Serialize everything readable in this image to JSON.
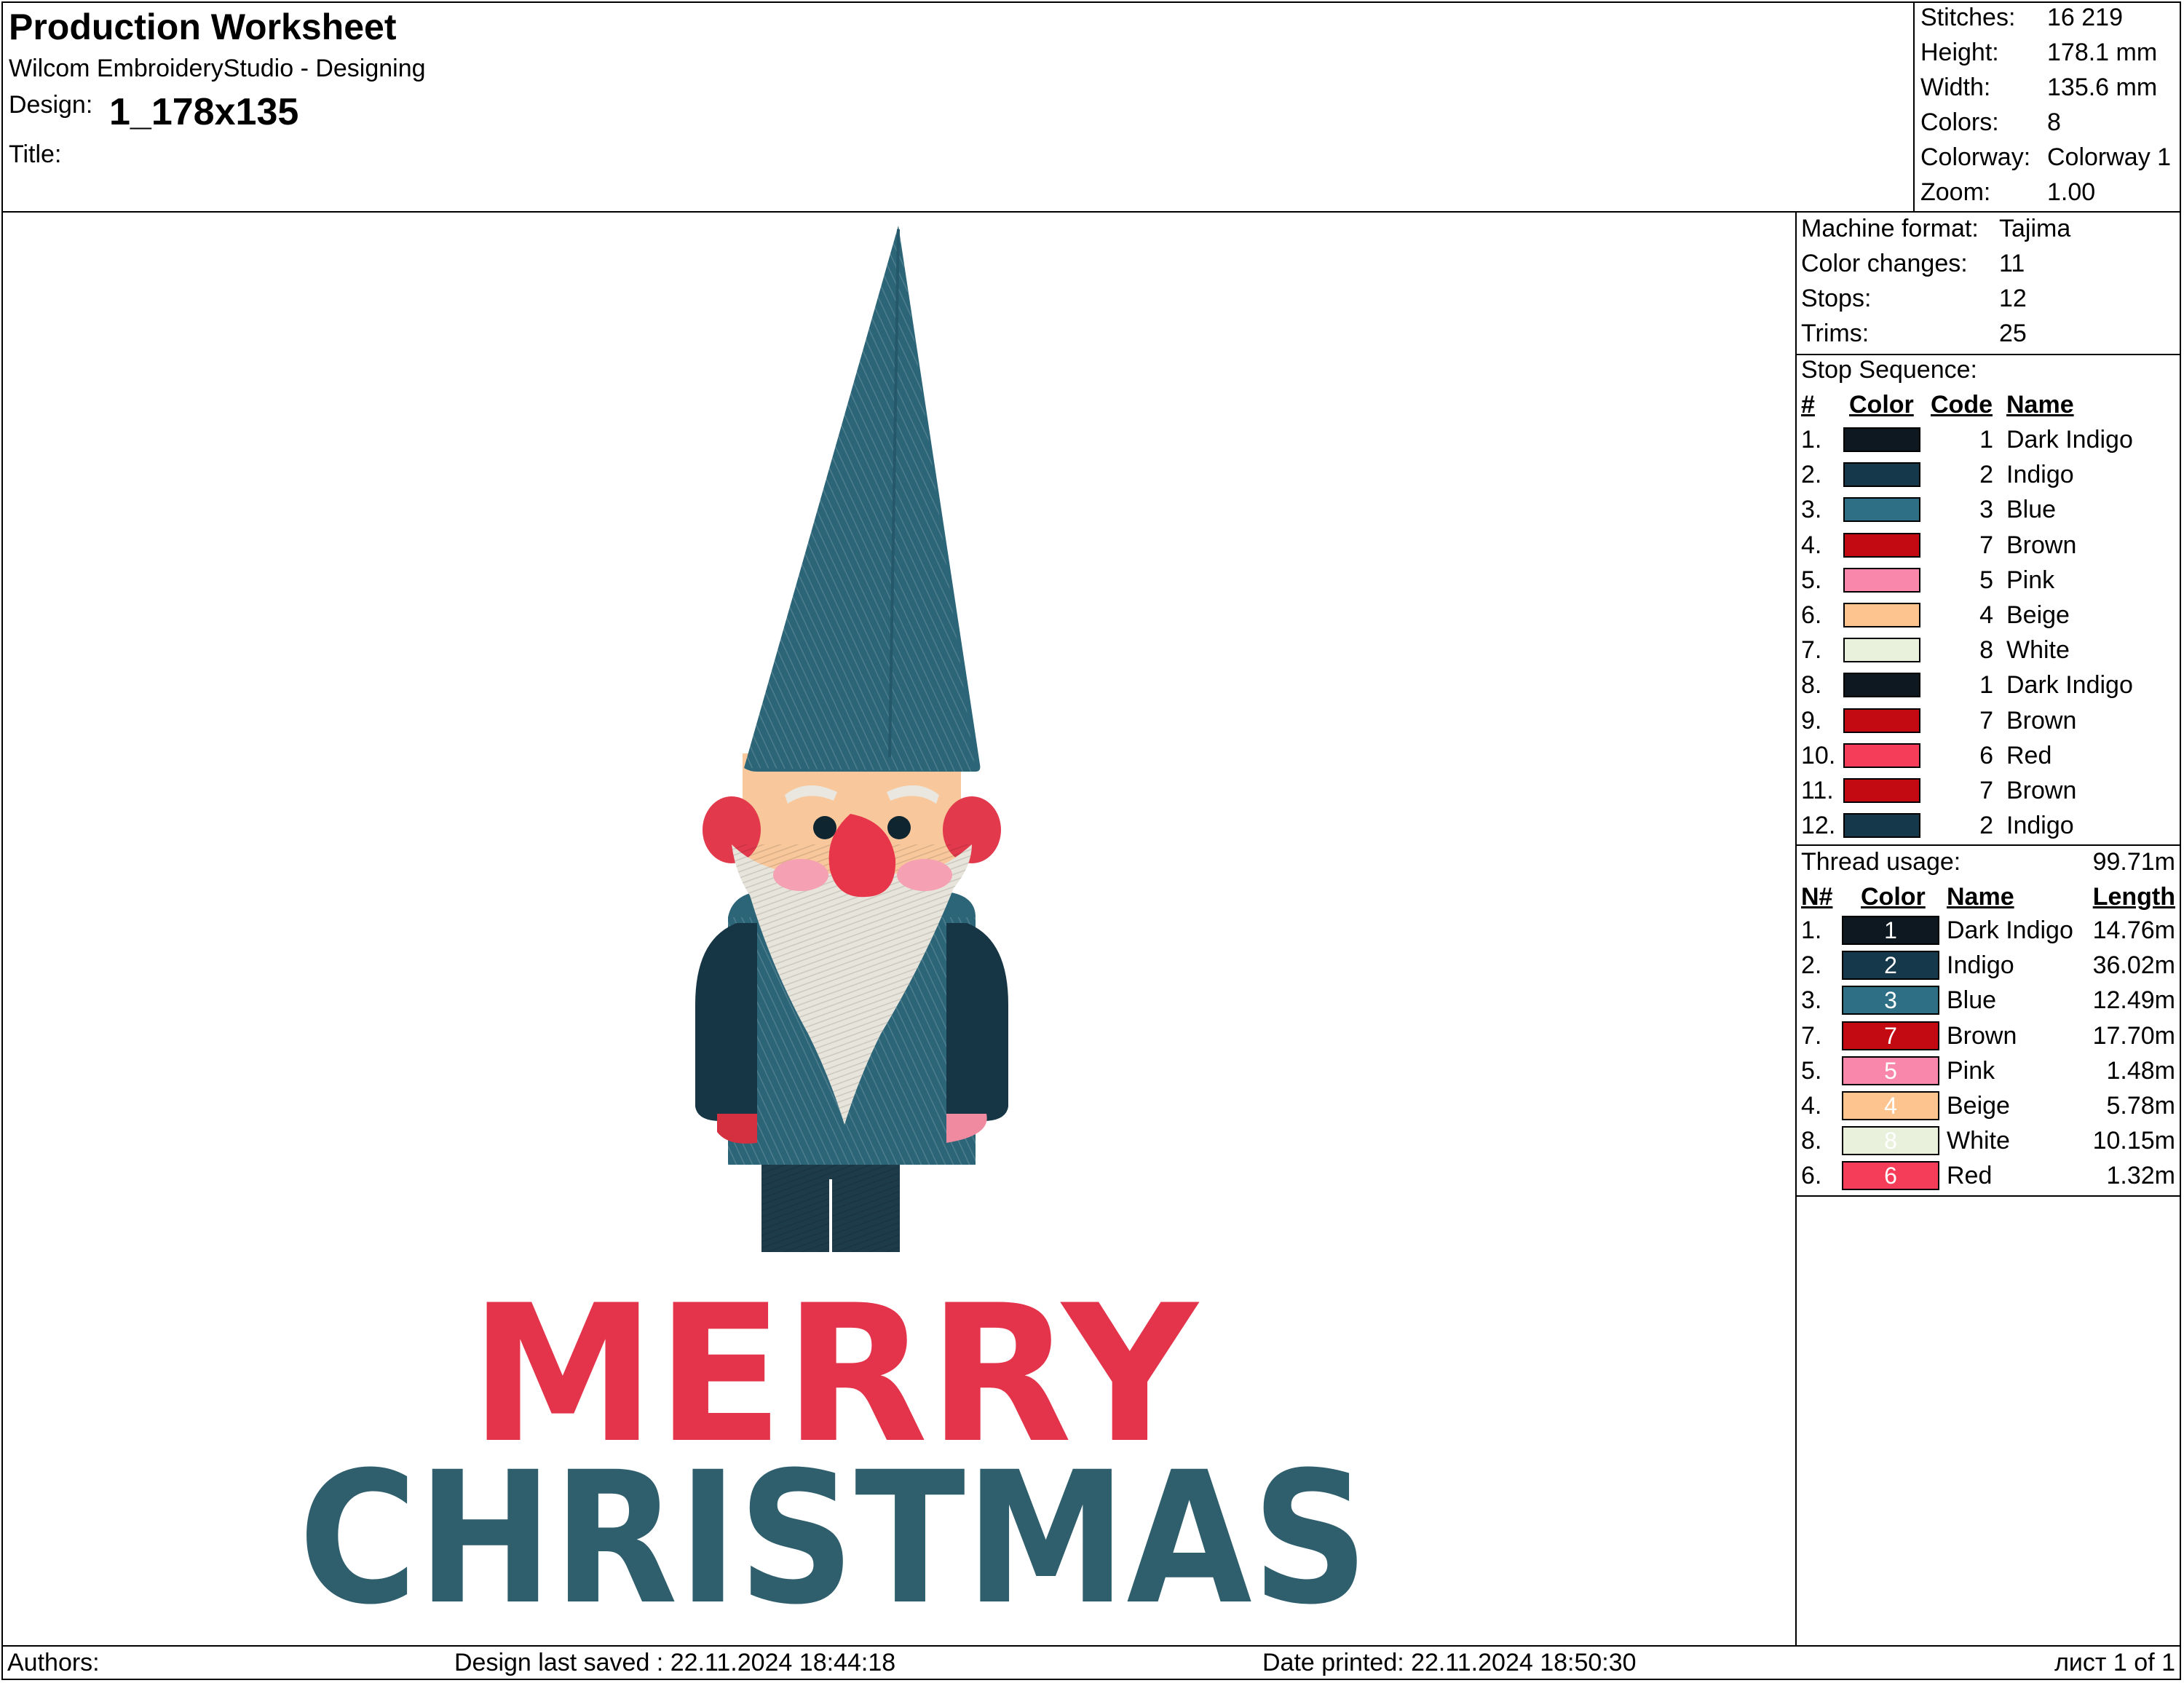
{
  "header": {
    "title": "Production Worksheet",
    "app": "Wilcom EmbroideryStudio - Designing",
    "design_label": "Design:",
    "design_value": "1_178x135",
    "title_label": "Title:",
    "title_value": ""
  },
  "stats": [
    {
      "label": "Stitches:",
      "value": "16 219"
    },
    {
      "label": "Height:",
      "value": "178.1 mm"
    },
    {
      "label": "Width:",
      "value": "135.6 mm"
    },
    {
      "label": "Colors:",
      "value": "8"
    },
    {
      "label": "Colorway:",
      "value": "Colorway 1"
    },
    {
      "label": "Zoom:",
      "value": "1.00"
    }
  ],
  "machine": [
    {
      "label": "Machine format:",
      "value": "Tajima"
    },
    {
      "label": "Color changes:",
      "value": "11"
    },
    {
      "label": "Stops:",
      "value": "12"
    },
    {
      "label": "Trims:",
      "value": "25"
    }
  ],
  "stop_sequence": {
    "title": "Stop Sequence:",
    "headers": {
      "num": "#",
      "color": "Color",
      "code": "Code",
      "name": "Name"
    },
    "rows": [
      {
        "num": "1.",
        "color": "#0d1820",
        "code": "1",
        "name": "Dark Indigo"
      },
      {
        "num": "2.",
        "color": "#15384a",
        "code": "2",
        "name": "Indigo"
      },
      {
        "num": "3.",
        "color": "#2e6f86",
        "code": "3",
        "name": "Blue"
      },
      {
        "num": "4.",
        "color": "#c30a12",
        "code": "7",
        "name": "Brown"
      },
      {
        "num": "5.",
        "color": "#f986ab",
        "code": "5",
        "name": "Pink"
      },
      {
        "num": "6.",
        "color": "#fdc48f",
        "code": "4",
        "name": "Beige"
      },
      {
        "num": "7.",
        "color": "#e9f0db",
        "code": "8",
        "name": "White"
      },
      {
        "num": "8.",
        "color": "#0d1820",
        "code": "1",
        "name": "Dark Indigo"
      },
      {
        "num": "9.",
        "color": "#c30a12",
        "code": "7",
        "name": "Brown"
      },
      {
        "num": "10.",
        "color": "#f53c58",
        "code": "6",
        "name": "Red"
      },
      {
        "num": "11.",
        "color": "#c30a12",
        "code": "7",
        "name": "Brown"
      },
      {
        "num": "12.",
        "color": "#15384a",
        "code": "2",
        "name": "Indigo"
      }
    ]
  },
  "thread_usage": {
    "title": "Thread usage:",
    "total": "99.71m",
    "headers": {
      "num": "N#",
      "color": "Color",
      "name": "Name",
      "length": "Length"
    },
    "rows": [
      {
        "num": "1.",
        "code": "1",
        "color": "#0d1820",
        "name": "Dark Indigo",
        "length": "14.76m"
      },
      {
        "num": "2.",
        "code": "2",
        "color": "#15384a",
        "name": "Indigo",
        "length": "36.02m"
      },
      {
        "num": "3.",
        "code": "3",
        "color": "#2e6f86",
        "name": "Blue",
        "length": "12.49m"
      },
      {
        "num": "7.",
        "code": "7",
        "color": "#c30a12",
        "name": "Brown",
        "length": "17.70m"
      },
      {
        "num": "5.",
        "code": "5",
        "color": "#f986ab",
        "name": "Pink",
        "length": "1.48m"
      },
      {
        "num": "4.",
        "code": "4",
        "color": "#fdc48f",
        "name": "Beige",
        "length": "5.78m"
      },
      {
        "num": "8.",
        "code": "8",
        "color": "#e9f0db",
        "name": "White",
        "length": "10.15m"
      },
      {
        "num": "6.",
        "code": "6",
        "color": "#f53c58",
        "name": "Red",
        "length": "1.32m"
      }
    ]
  },
  "artwork": {
    "line1": "MERRY",
    "line2": "CHRISTMAS"
  },
  "footer": {
    "authors": "Authors:",
    "saved": "Design last saved : 22.11.2024 18:44:18",
    "printed": "Date printed: 22.11.2024 18:50:30",
    "page": "лист 1 of 1"
  }
}
